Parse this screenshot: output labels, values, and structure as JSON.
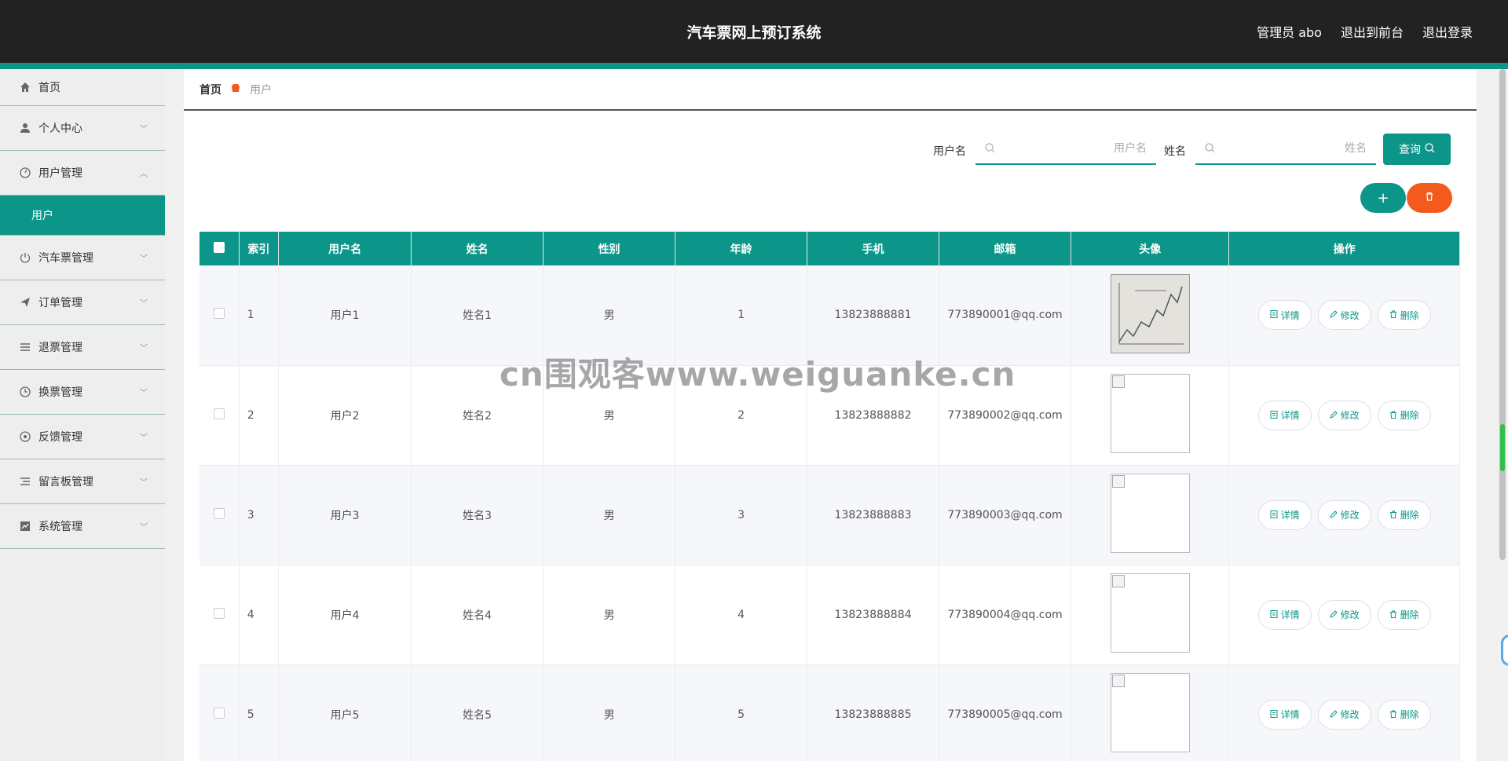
{
  "header": {
    "title": "汽车票网上预订系统",
    "admin": "管理员 abo",
    "to_front": "退出到前台",
    "logout": "退出登录"
  },
  "sidebar": {
    "items": [
      {
        "label": "首页",
        "icon": "home-icon"
      },
      {
        "label": "个人中心",
        "icon": "user-icon"
      },
      {
        "label": "用户管理",
        "icon": "dashboard-icon",
        "expanded": true,
        "children": [
          {
            "label": "用户",
            "active": true
          }
        ]
      },
      {
        "label": "汽车票管理",
        "icon": "power-icon"
      },
      {
        "label": "订单管理",
        "icon": "send-icon"
      },
      {
        "label": "退票管理",
        "icon": "list-icon"
      },
      {
        "label": "换票管理",
        "icon": "clock-icon"
      },
      {
        "label": "反馈管理",
        "icon": "target-icon"
      },
      {
        "label": "留言板管理",
        "icon": "menu-icon"
      },
      {
        "label": "系统管理",
        "icon": "chart-icon"
      }
    ]
  },
  "breadcrumb": {
    "home": "首页",
    "current": "用户"
  },
  "search": {
    "username_label": "用户名",
    "username_placeholder": "用户名",
    "name_label": "姓名",
    "name_placeholder": "姓名",
    "query_label": "查询"
  },
  "actions": {
    "add": "+",
    "delete_icon": "trash-icon"
  },
  "table": {
    "headers": [
      "",
      "索引",
      "用户名",
      "姓名",
      "性别",
      "年龄",
      "手机",
      "邮箱",
      "头像",
      "操作"
    ],
    "rows": [
      {
        "index": "1",
        "username": "用户1",
        "name": "姓名1",
        "gender": "男",
        "age": "1",
        "phone": "13823888881",
        "email": "773890001@qq.com",
        "avatar": "photo"
      },
      {
        "index": "2",
        "username": "用户2",
        "name": "姓名2",
        "gender": "男",
        "age": "2",
        "phone": "13823888882",
        "email": "773890002@qq.com",
        "avatar": "broken"
      },
      {
        "index": "3",
        "username": "用户3",
        "name": "姓名3",
        "gender": "男",
        "age": "3",
        "phone": "13823888883",
        "email": "773890003@qq.com",
        "avatar": "broken"
      },
      {
        "index": "4",
        "username": "用户4",
        "name": "姓名4",
        "gender": "男",
        "age": "4",
        "phone": "13823888884",
        "email": "773890004@qq.com",
        "avatar": "broken"
      },
      {
        "index": "5",
        "username": "用户5",
        "name": "姓名5",
        "gender": "男",
        "age": "5",
        "phone": "13823888885",
        "email": "773890005@qq.com",
        "avatar": "broken"
      }
    ],
    "op_labels": {
      "detail": "详情",
      "edit": "修改",
      "delete": "删除"
    }
  },
  "watermark": "cn围观客www.weiguanke.cn",
  "colors": {
    "accent": "#0c9689",
    "danger": "#f35a1d",
    "header_bg": "#222222"
  }
}
